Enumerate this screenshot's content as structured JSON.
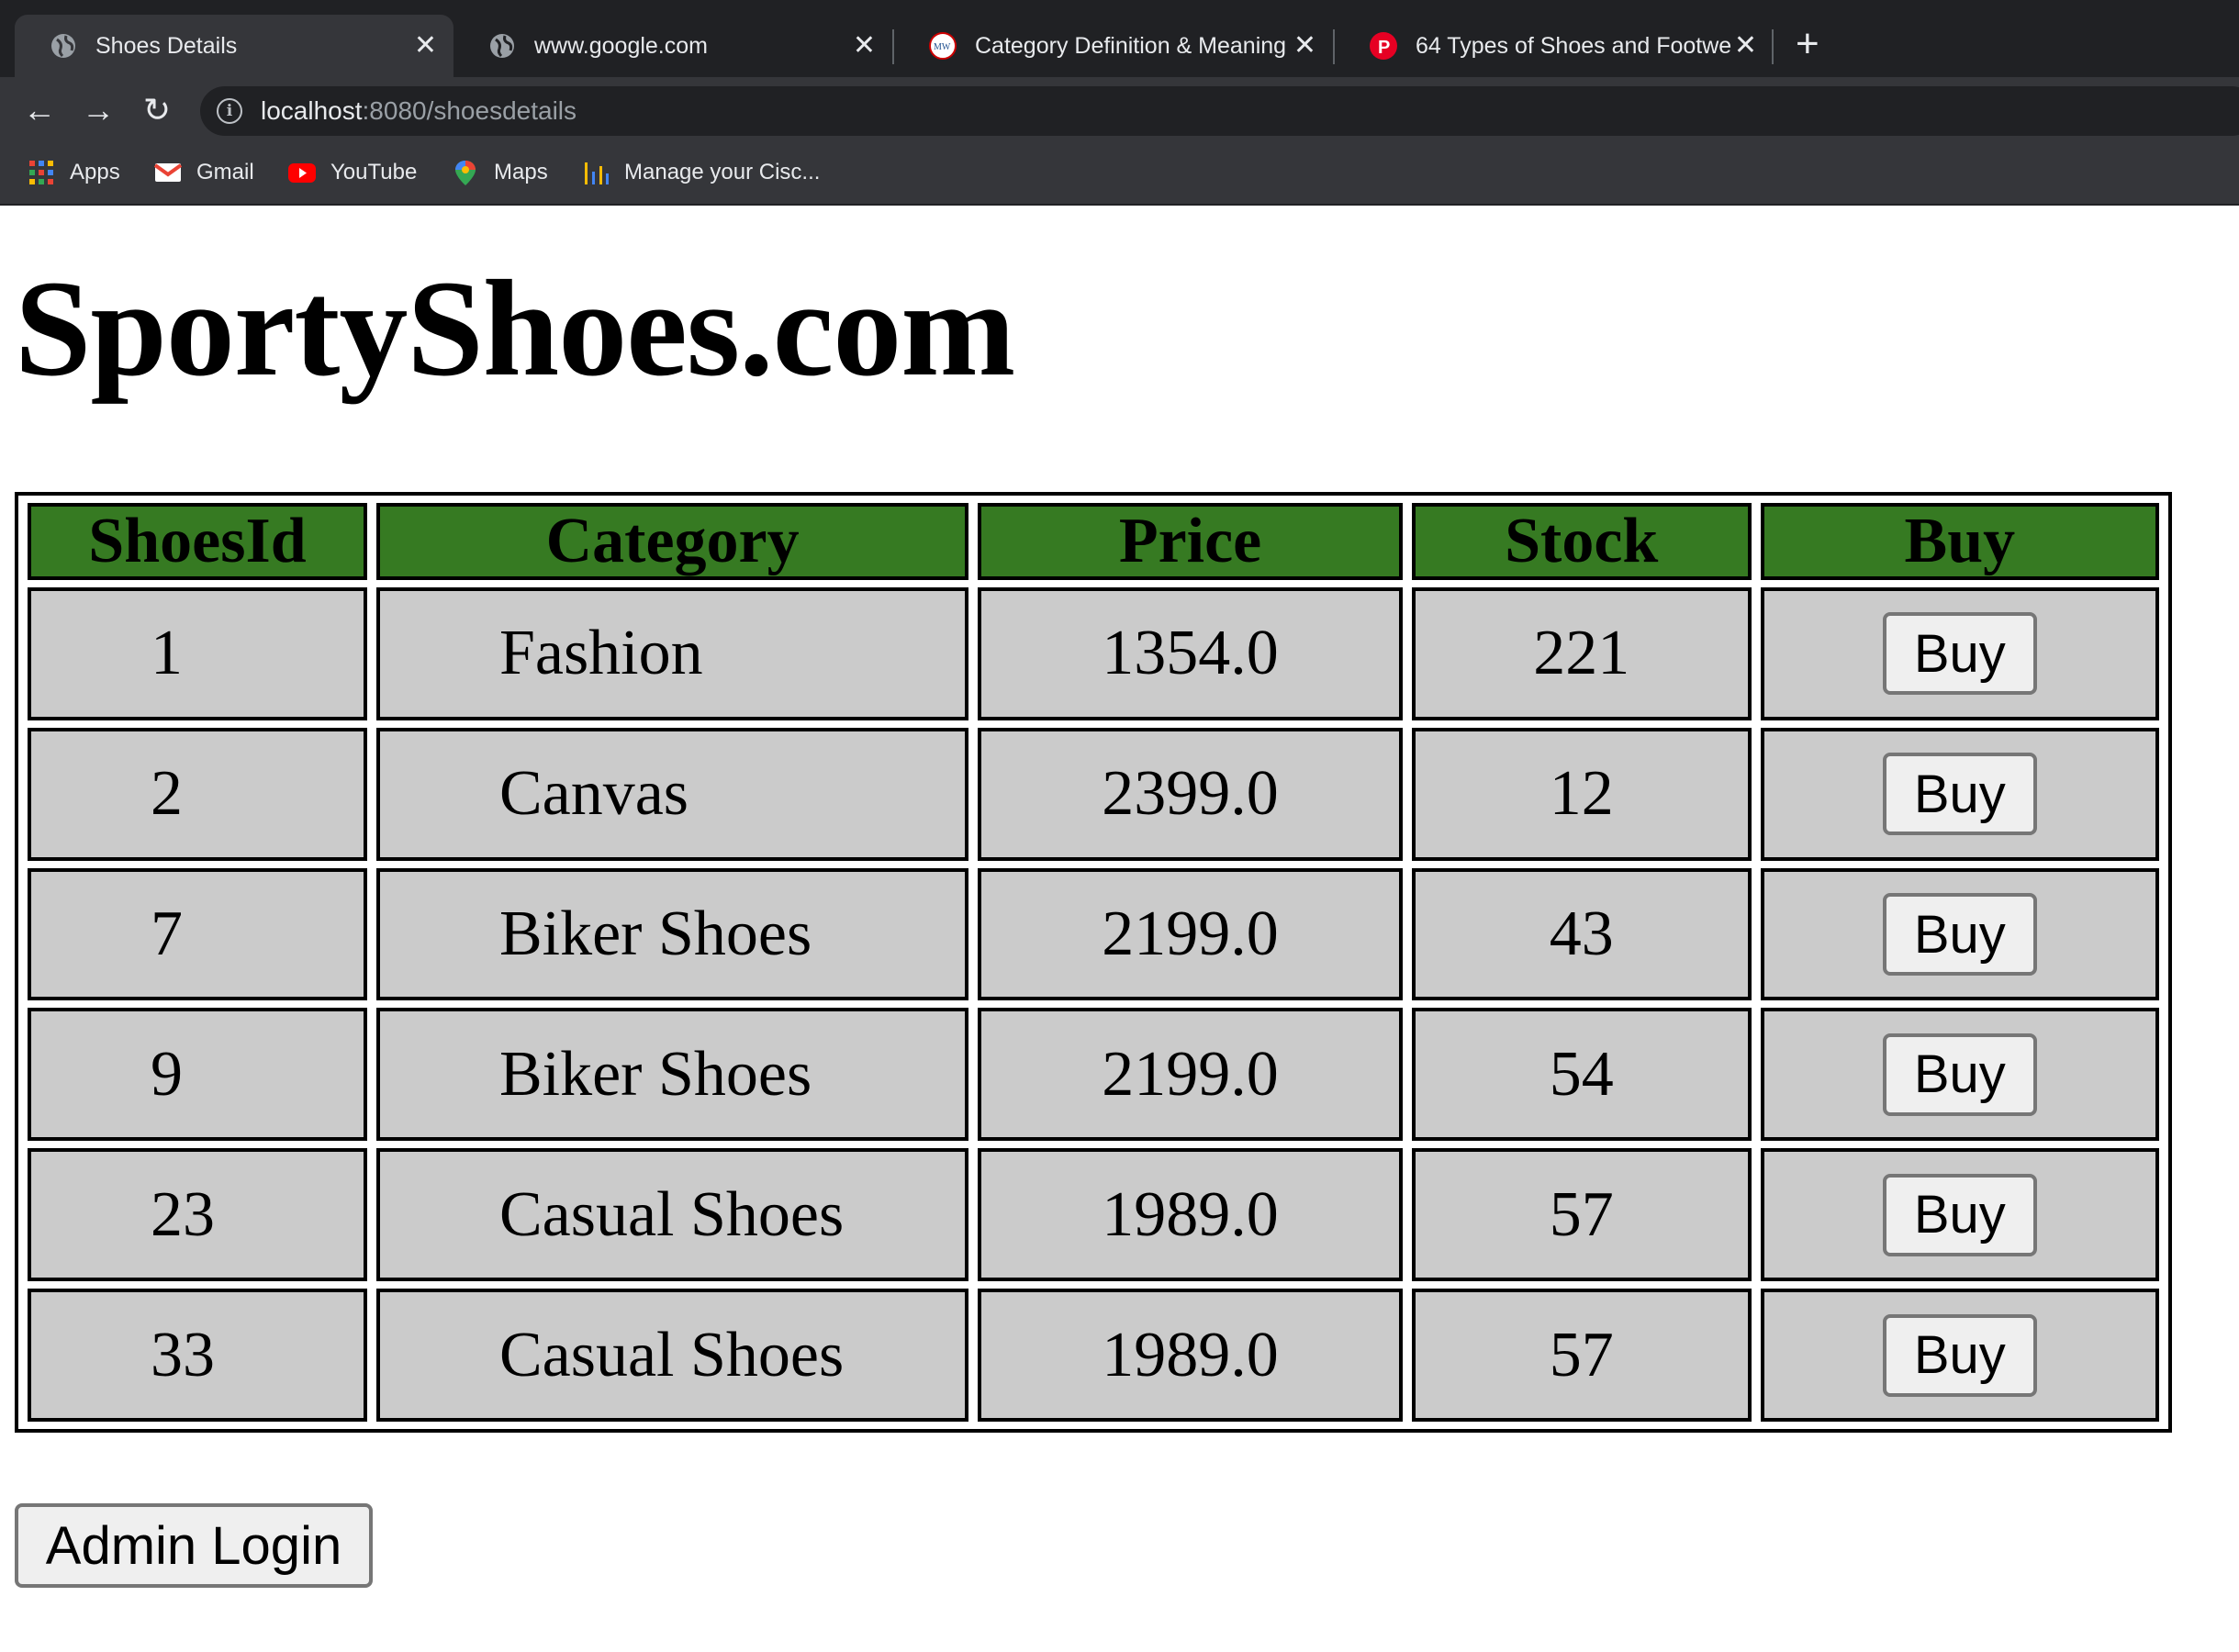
{
  "browser": {
    "tabs": [
      {
        "title": "Shoes Details",
        "icon": "globe-icon",
        "active": true
      },
      {
        "title": "www.google.com",
        "icon": "globe-icon",
        "active": false
      },
      {
        "title": "Category Definition & Meaning",
        "icon": "merriam-webster-icon",
        "active": false
      },
      {
        "title": "64 Types of Shoes and Footwe",
        "icon": "pinterest-icon",
        "active": false
      }
    ],
    "url_host": "localhost",
    "url_path": ":8080/shoesdetails",
    "bookmarks": [
      {
        "label": "Apps",
        "icon": "apps-grid-icon"
      },
      {
        "label": "Gmail",
        "icon": "gmail-icon"
      },
      {
        "label": "YouTube",
        "icon": "youtube-icon"
      },
      {
        "label": "Maps",
        "icon": "maps-icon"
      },
      {
        "label": "Manage your Cisc...",
        "icon": "cisco-icon"
      }
    ]
  },
  "page": {
    "title": "SportyShoes.com",
    "table": {
      "headers": [
        "ShoesId",
        "Category",
        "Price",
        "Stock",
        "Buy"
      ],
      "rows": [
        {
          "id": "1",
          "category": "Fashion",
          "price": "1354.0",
          "stock": "221",
          "action": "Buy"
        },
        {
          "id": "2",
          "category": "Canvas",
          "price": "2399.0",
          "stock": "12",
          "action": "Buy"
        },
        {
          "id": "7",
          "category": "Biker Shoes",
          "price": "2199.0",
          "stock": "43",
          "action": "Buy"
        },
        {
          "id": "9",
          "category": "Biker Shoes",
          "price": "2199.0",
          "stock": "54",
          "action": "Buy"
        },
        {
          "id": "23",
          "category": "Casual Shoes",
          "price": "1989.0",
          "stock": "57",
          "action": "Buy"
        },
        {
          "id": "33",
          "category": "Casual Shoes",
          "price": "1989.0",
          "stock": "57",
          "action": "Buy"
        }
      ]
    },
    "admin_button": "Admin Login"
  },
  "colors": {
    "header_bg": "#367a22",
    "cell_bg": "#cbcbcb",
    "chrome_dark": "#202124",
    "chrome_mid": "#35363a"
  }
}
